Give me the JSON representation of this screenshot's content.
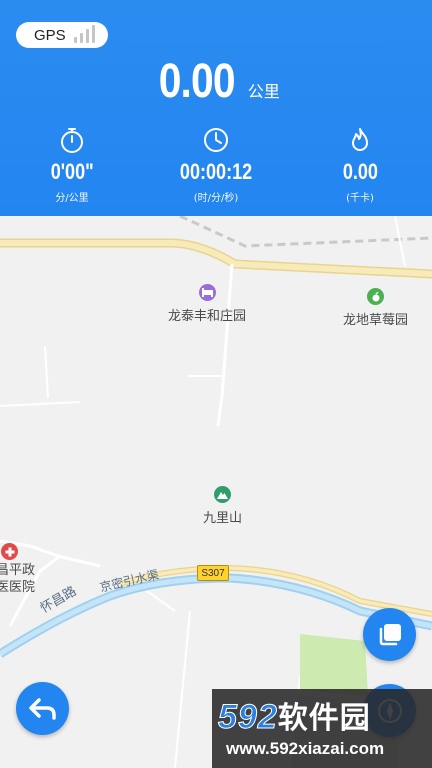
{
  "header": {
    "gps_label": "GPS",
    "distance_value": "0.00",
    "distance_unit": "公里",
    "stats": [
      {
        "icon": "stopwatch-icon",
        "value": "0'00\"",
        "unit": "分/公里"
      },
      {
        "icon": "clock-icon",
        "value": "00:00:12",
        "unit": "(时/分/秒)"
      },
      {
        "icon": "flame-icon",
        "value": "0.00",
        "unit": "(千卡)"
      }
    ]
  },
  "map": {
    "pois": [
      {
        "name": "龙泰丰和庄园",
        "icon": "hotel-icon",
        "color": "#9b6ddb"
      },
      {
        "name": "龙地草莓园",
        "icon": "fruit-icon",
        "color": "#4caf50"
      },
      {
        "name": "九里山",
        "icon": "mountain-icon",
        "color": "#2e9e6a"
      }
    ],
    "hospital_label_line1": "昌平政",
    "hospital_label_line2": "医医院",
    "roads": {
      "huaichang": "怀昌路",
      "jingmi": "京密引水渠",
      "route_shield": "S307"
    }
  },
  "buttons": {
    "back": "back-arrow-icon",
    "layers": "layers-icon",
    "compass": "compass-icon"
  },
  "watermark": {
    "brand_number": "592",
    "brand_text": "软件园",
    "url": "www.592xiazai.com"
  },
  "colors": {
    "primary": "#2385f0",
    "map_bg": "#f1f1f1",
    "road_yellow": "#f6e3a5",
    "water": "#b3dcf4",
    "green_area": "#cdeab0"
  }
}
